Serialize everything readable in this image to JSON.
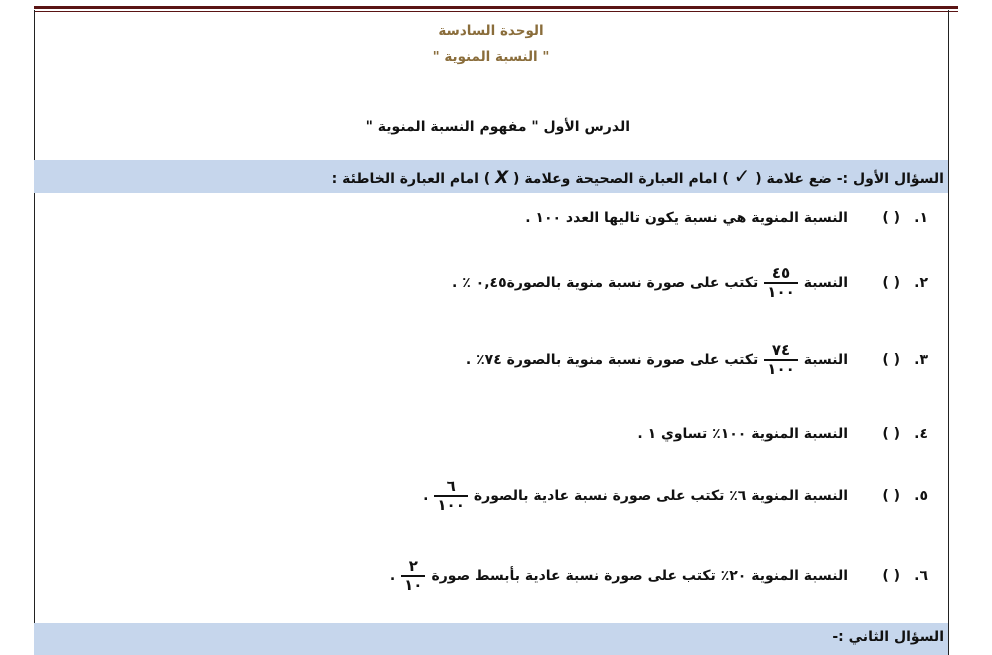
{
  "header": {
    "unit_title": "الوحدة السادسة",
    "unit_subtitle": "\" النسبة المنوية \""
  },
  "lesson": {
    "title": "الدرس الأول \" مفهوم النسبة المنوية \""
  },
  "question1": {
    "heading_a": "السؤال الأول :- ضع علامة (",
    "check_symbol": "✓",
    "heading_b": ") امام العبارة الصحيحة وعلامة (",
    "x_symbol": "X",
    "heading_c": ") امام العبارة الخاطئة :",
    "items": [
      {
        "num": "١.",
        "paren": "(      )",
        "text": "النسبة المنوية هي نسبة يكون تاليها العدد ١٠٠ ."
      },
      {
        "num": "٢.",
        "paren": "(      )",
        "pre": "النسبة",
        "frac_n": "٤٥",
        "frac_d": "١٠٠",
        "post": "تكتب على صورة نسبة منوية بالصورة٠,٤٥ ٪ ."
      },
      {
        "num": "٣.",
        "paren": "(      )",
        "pre": "النسبة",
        "frac_n": "٧٤",
        "frac_d": "١٠٠",
        "post": "تكتب على صورة نسبة منوية بالصورة ٧٤٪ ."
      },
      {
        "num": "٤.",
        "paren": "(      )",
        "text": "النسبة المنوية ١٠٠٪ تساوي ١ ."
      },
      {
        "num": "٥.",
        "paren": "(      )",
        "pre": "النسبة المنوية ٦٪ تكتب على صورة نسبة عادية بالصورة",
        "frac_n": "٦",
        "frac_d": "١٠٠",
        "post": "."
      },
      {
        "num": "٦.",
        "paren": "(      )",
        "pre": "النسبة المنوية ٢٠٪ تكتب على صورة نسبة عادية بأبسط صورة",
        "frac_n": "٢",
        "frac_d": "١٠",
        "post": "."
      }
    ]
  },
  "question2": {
    "heading": "السؤال الثاني :-"
  },
  "colors": {
    "band": "#c6d6ec",
    "title": "#8a6d3b",
    "rule": "#5a1414"
  }
}
